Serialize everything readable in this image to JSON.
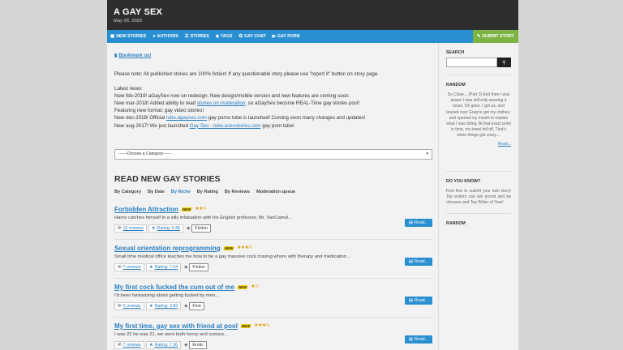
{
  "site": {
    "title": "A GAY SEX",
    "date": "May 26, 2020"
  },
  "nav": {
    "items": [
      {
        "label": "NEW STORIES",
        "icon": "grid-icon"
      },
      {
        "label": "AUTHORS",
        "icon": "user-icon"
      },
      {
        "label": "STORIES",
        "icon": "list-icon"
      },
      {
        "label": "TAGS",
        "icon": "tags-icon"
      },
      {
        "label": "GAY CHAT",
        "icon": "chat-icon"
      },
      {
        "label": "GAY PORN",
        "icon": "video-icon"
      }
    ],
    "submit": "SUBMIT STORY"
  },
  "main": {
    "bookmark": "Bookmark us!",
    "note": "Please note: All published stories are 100% fiction! If any questionable story please use \"report it\" button on story page.",
    "news": {
      "heading": "Latest news:",
      "l1": "New feb-2019! aGaySex now on redesign. New design/mobile version and new features are coming soon.",
      "l2a": "New mar-2018! Added ability to read ",
      "l2link": "stories on moderation",
      "l2b": ", so aGaySex become REAL-Time gay stories post!",
      "l3": "Featuring new format: gay video stories!",
      "l4a": "New dec-2018! Official ",
      "l4link": "tube.agaysex.com",
      "l4b": " gay porno tube is launched! Coming soon many changes and updates!",
      "l5a": "New aug-2017! We just launched ",
      "l5link": "Gay Sex - tube.asexstories.com",
      "l5b": " gay porn tube!"
    },
    "category_select": "------Choose a Category------",
    "stories_heading": "READ NEW GAY STORIES",
    "sort_tabs": [
      "By Category",
      "By Date",
      "By Niche",
      "By Rating",
      "By Reviews",
      "Moderation queue"
    ],
    "active_sort": "By Niche",
    "stories": [
      {
        "title": "Forbidden Attraction",
        "badge": "NEW",
        "stars": "★★½",
        "summary": "Harris catches himself in a silly infatuation with his English professor, Mr. VanCamel...",
        "reviews": "16 reviews",
        "rating": "Rating: 5.86",
        "tag": "Fiction",
        "read": "Read..."
      },
      {
        "title": "Sexual orientation reprogramming",
        "badge": "NEW",
        "stars": "★★★½",
        "summary": "Small time medical office teaches me how to be a gay massive cock craving whore with therapy and medication...",
        "reviews": "7 reviews",
        "rating": "Rating: 7.54",
        "tag": "Fiction",
        "read": "Read..."
      },
      {
        "title": "My first cock fucked the cum out of me",
        "badge": "NEW",
        "stars": "★½",
        "summary": "I'd been fantasizing about getting fucked by men...",
        "reviews": "5 reviews",
        "rating": "Rating: 3.83",
        "tag": "First",
        "read": "Read..."
      },
      {
        "title": "My first time, gay sex with friend at pool",
        "badge": "NEW",
        "stars": "★★★½",
        "summary": "I was 22 he was 21, we were both horny and curious...",
        "reviews": "7 reviews",
        "rating": "Rating: 7.30",
        "tag": "Erotic",
        "read": "Read..."
      }
    ]
  },
  "sidebar": {
    "search_label": "SEARCH",
    "random_label": "RANDOM",
    "random_text": "So Close... (Part 3) And then I was aware I was still only wearing a towel. Oh geez. I got us, and leaned over Greg to get my clothes, and opened my mouth to explain what I was doing. At that exact point in time, my towel fell off. That's when things got crazy....",
    "random_more": "Read...",
    "dyk_label": "DO YOU KNOW?",
    "dyk_text": "Feel free to submit your own story! Top writers can win prized and be chooses and Top Writer of Year!",
    "random2_label": "RANDOM"
  }
}
